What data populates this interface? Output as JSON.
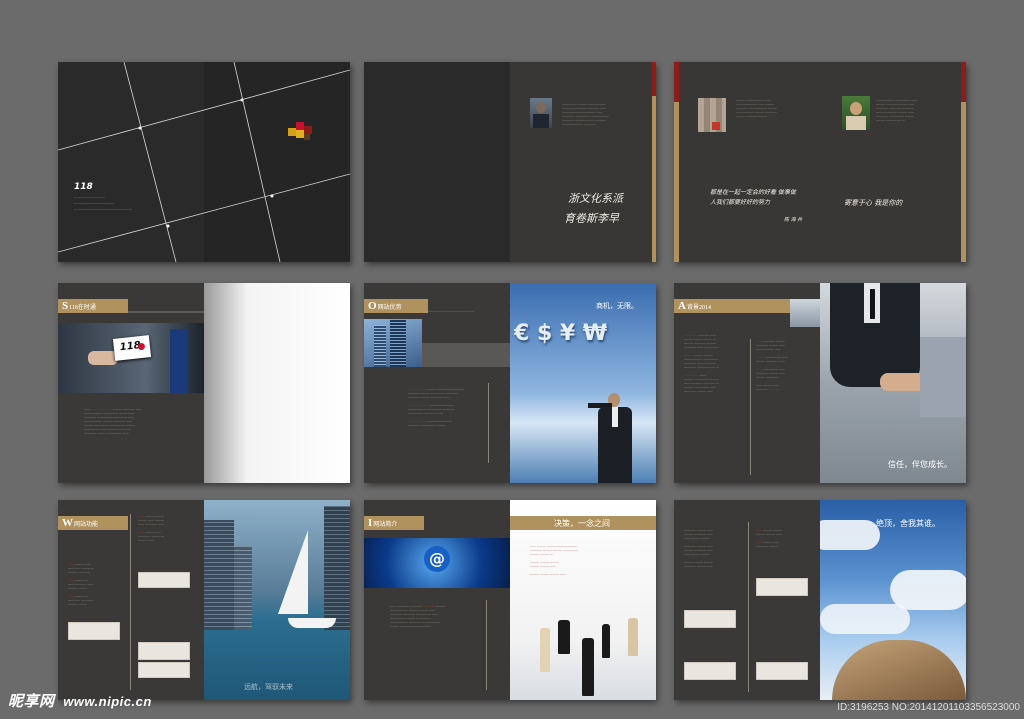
{
  "colors": {
    "background": "#6b6b6b",
    "page_dark": "#2a2a2a",
    "page_gray": "#3a3938",
    "accent_gold": "#b0925e",
    "accent_red": "#b71c1c"
  },
  "spread1": {
    "logo": "118",
    "text_lines": [
      "—  —————————",
      "—  ————————————",
      "—  ——————————————————"
    ]
  },
  "spread2": {
    "signature_line1": "浙文化系派",
    "signature_line2": "育卷斯李早"
  },
  "spread3": {
    "sig_a": "都是在一起一定会的好看  做事做人我们都要好好的努力",
    "sig_a_name": "陈 海 兵",
    "sig_b": "寄意于心  我是你的"
  },
  "spread4": {
    "title_letter": "S",
    "title_text": "118在时通",
    "card_text": "118"
  },
  "spread5": {
    "title_letter": "O",
    "title_text": "网站优势",
    "caption": "商机，无限。",
    "symbols": "€ $ ¥ ₩"
  },
  "spread6": {
    "title_letter": "A",
    "title_text": "背景2014",
    "caption": "信任，伴您成长。"
  },
  "spread7": {
    "title_letter": "W",
    "title_text": "网站功能",
    "caption": "远航，驾驭未来"
  },
  "spread8": {
    "title_letter": "I",
    "title_text": "网站简介",
    "caption": "决策，一念之间",
    "at_symbol": "@"
  },
  "spread9": {
    "caption": "绝顶，舍我其谁。"
  },
  "watermark": {
    "brand": "昵享网",
    "url": "www.nipic.cn"
  },
  "image_id": "ID:3196253 NO:20141201103356523000"
}
